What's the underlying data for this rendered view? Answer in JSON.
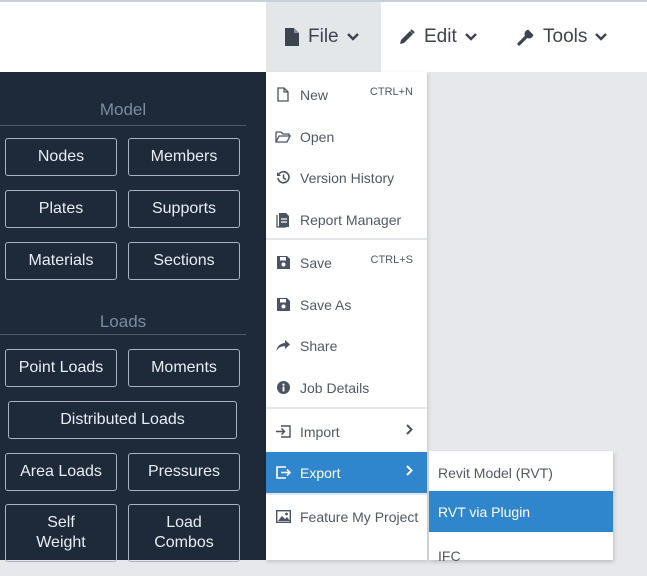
{
  "topbar": {
    "menus": [
      {
        "label": "File",
        "icon": "file-icon",
        "active": true
      },
      {
        "label": "Edit",
        "icon": "pencil-icon",
        "active": false
      },
      {
        "label": "Tools",
        "icon": "wrench-icon",
        "active": false
      }
    ]
  },
  "sidebar": {
    "sections": [
      {
        "title": "Model",
        "buttons": [
          "Nodes",
          "Members",
          "Plates",
          "Supports",
          "Materials",
          "Sections"
        ]
      },
      {
        "title": "Loads",
        "buttons": [
          "Point Loads",
          "Moments",
          "Distributed Loads",
          "Area Loads",
          "Pressures",
          "Self Weight",
          "Load Combos"
        ]
      }
    ],
    "colors": {
      "background": "#1e2a3a",
      "title": "#7e8ba0"
    }
  },
  "file_menu": {
    "items": [
      {
        "label": "New",
        "icon": "new-file-icon",
        "shortcut": "CTRL+N"
      },
      {
        "label": "Open",
        "icon": "folder-open-icon"
      },
      {
        "label": "Version History",
        "icon": "history-icon"
      },
      {
        "label": "Report Manager",
        "icon": "report-icon"
      },
      {
        "label": "Save",
        "icon": "save-icon",
        "shortcut": "CTRL+S"
      },
      {
        "label": "Save As",
        "icon": "save-as-icon"
      },
      {
        "label": "Share",
        "icon": "share-icon"
      },
      {
        "label": "Job Details",
        "icon": "info-icon"
      },
      {
        "label": "Import",
        "icon": "import-icon",
        "has_submenu": true
      },
      {
        "label": "Export",
        "icon": "export-icon",
        "has_submenu": true,
        "selected": true
      },
      {
        "label": "Feature My Project",
        "icon": "image-icon"
      }
    ]
  },
  "export_submenu": {
    "items": [
      {
        "label": "Revit Model (RVT)"
      },
      {
        "label": "RVT via Plugin",
        "selected": true
      },
      {
        "label": "IFC"
      }
    ]
  },
  "accent_color": "#2f86cc"
}
